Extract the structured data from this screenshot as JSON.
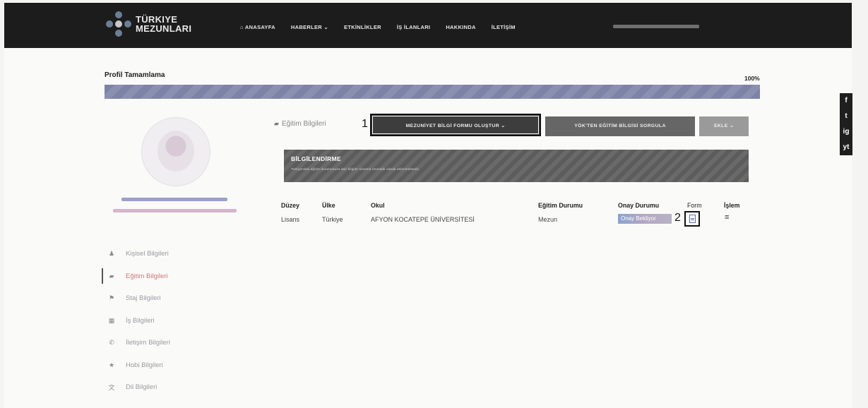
{
  "brand": {
    "line1": "TÜRKIYE",
    "line2": "MEZUNLARI"
  },
  "nav": [
    "⌂ ANASAYFA",
    "HABERLER ⌄",
    "ETKİNLİKLER",
    "İŞ İLANLARI",
    "HAKKINDA",
    "İLETİŞİM"
  ],
  "progress": {
    "title": "Profil Tamamlama",
    "percent_label": "100%",
    "value": 1.0
  },
  "sidebar": [
    {
      "label": "Kişisel Bilgileri",
      "icon": "user-icon"
    },
    {
      "label": "Eğitim Bilgileri",
      "icon": "graduation-icon"
    },
    {
      "label": "Staj Bilgileri",
      "icon": "briefcase-icon"
    },
    {
      "label": "İş Bilgileri",
      "icon": "building-icon"
    },
    {
      "label": "İletişim Bilgileri",
      "icon": "phone-icon"
    },
    {
      "label": "Hobi Bilgileri",
      "icon": "star-icon"
    },
    {
      "label": "Dil Bilgileri",
      "icon": "language-icon"
    }
  ],
  "social": [
    "f",
    "t",
    "ig",
    "yt"
  ],
  "section": {
    "label": "Eğitim Bilgileri",
    "marker1": "1",
    "marker2": "2",
    "create_button": "MEZUNİYET BİLGİ FORMU OLUŞTUR ⌄",
    "yok_button": "YÖK'TEN EĞİTİM BİLGİSİ SORGULA",
    "add_button": "EKLE ⌄"
  },
  "info": {
    "title": "BİLGİLENDİRME",
    "text": "Türkiye'deki eğitim durumunuza dair bilgiler sisteme otomatik olarak eklenmektedir."
  },
  "table": {
    "headers": [
      "Düzey",
      "Ülke",
      "Okul",
      "Eğitim Durumu",
      "Onay Durumu",
      "Form",
      "İşlem"
    ],
    "rows": [
      {
        "level": "Lisans",
        "country": "Türkiye",
        "school": "AFYON KOCATEPE ÜNİVERSİTESİ",
        "status": "Mezun",
        "approval": "Onay Bekliyor"
      }
    ]
  },
  "colors": {
    "navbar": "#1c1c1c",
    "progress": "#7d83a6",
    "badge": "#88a3cf"
  }
}
